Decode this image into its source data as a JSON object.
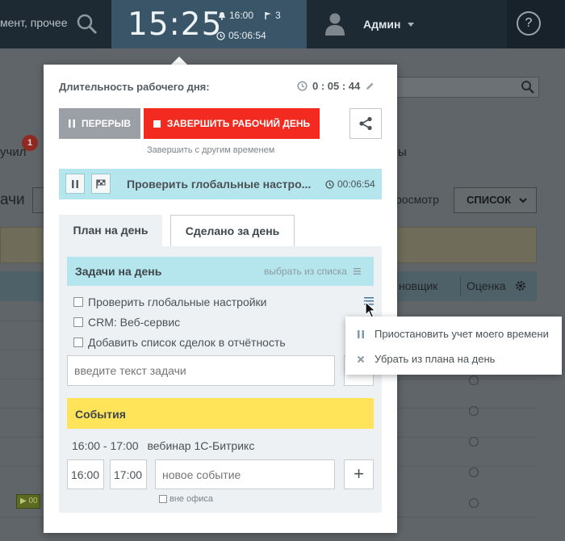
{
  "topbar": {
    "search_text": "мент, прочее",
    "clock_time": "15:25",
    "alarm_time": "16:00",
    "flags_count": "3",
    "elapsed": "05:06:54",
    "user_name": "Админ",
    "help": "?"
  },
  "background": {
    "label_left_1": "учил",
    "badge_count": "1",
    "label_right_1": "ы",
    "label_left_2": "ачи",
    "label_view": "росмотр",
    "list_button": "СПИСОК",
    "col_executor": "новщик",
    "col_rating": "Оценка"
  },
  "popup": {
    "title": "Длительность рабочего дня:",
    "duration": "0 : 05 : 44",
    "pause_label": "ПЕРЕРЫВ",
    "finish_label": "ЗАВЕРШИТЬ РАБОЧИЙ ДЕНЬ",
    "finish_other": "Завершить с другим временем",
    "current_task": {
      "title": "Проверить глобальные настро...",
      "time": "00:06:54"
    },
    "tabs": [
      {
        "label": "План на день",
        "active": true
      },
      {
        "label": "Сделано за день",
        "active": false
      }
    ],
    "tasks_header": "Задачи на день",
    "tasks_pick": "выбрать из списка",
    "tasks": [
      {
        "label": "Проверить глобальные настройки",
        "checked": false
      },
      {
        "label": "CRM: Веб-сервис",
        "checked": false
      },
      {
        "label": "Добавить список сделок в отчётность",
        "checked": false
      }
    ],
    "task_input_placeholder": "введите текст задачи",
    "events_header": "События",
    "events": [
      {
        "time": "16:00 - 17:00",
        "title": "вебинар 1С-Битрикс"
      }
    ],
    "new_event": {
      "from": "16:00",
      "to": "17:00",
      "placeholder": "новое событие",
      "add_label": "+",
      "out_of_office": "вне офиса"
    }
  },
  "context_menu": {
    "items": [
      {
        "icon": "pause-icon",
        "label": "Приостановить учет моего времени"
      },
      {
        "icon": "close-icon",
        "label": "Убрать из плана на день"
      }
    ]
  },
  "colors": {
    "accent_red": "#f32a1f",
    "task_blue": "#b5e6ed",
    "events_yellow": "#ffe45a",
    "clock_bg": "#3a5567"
  }
}
